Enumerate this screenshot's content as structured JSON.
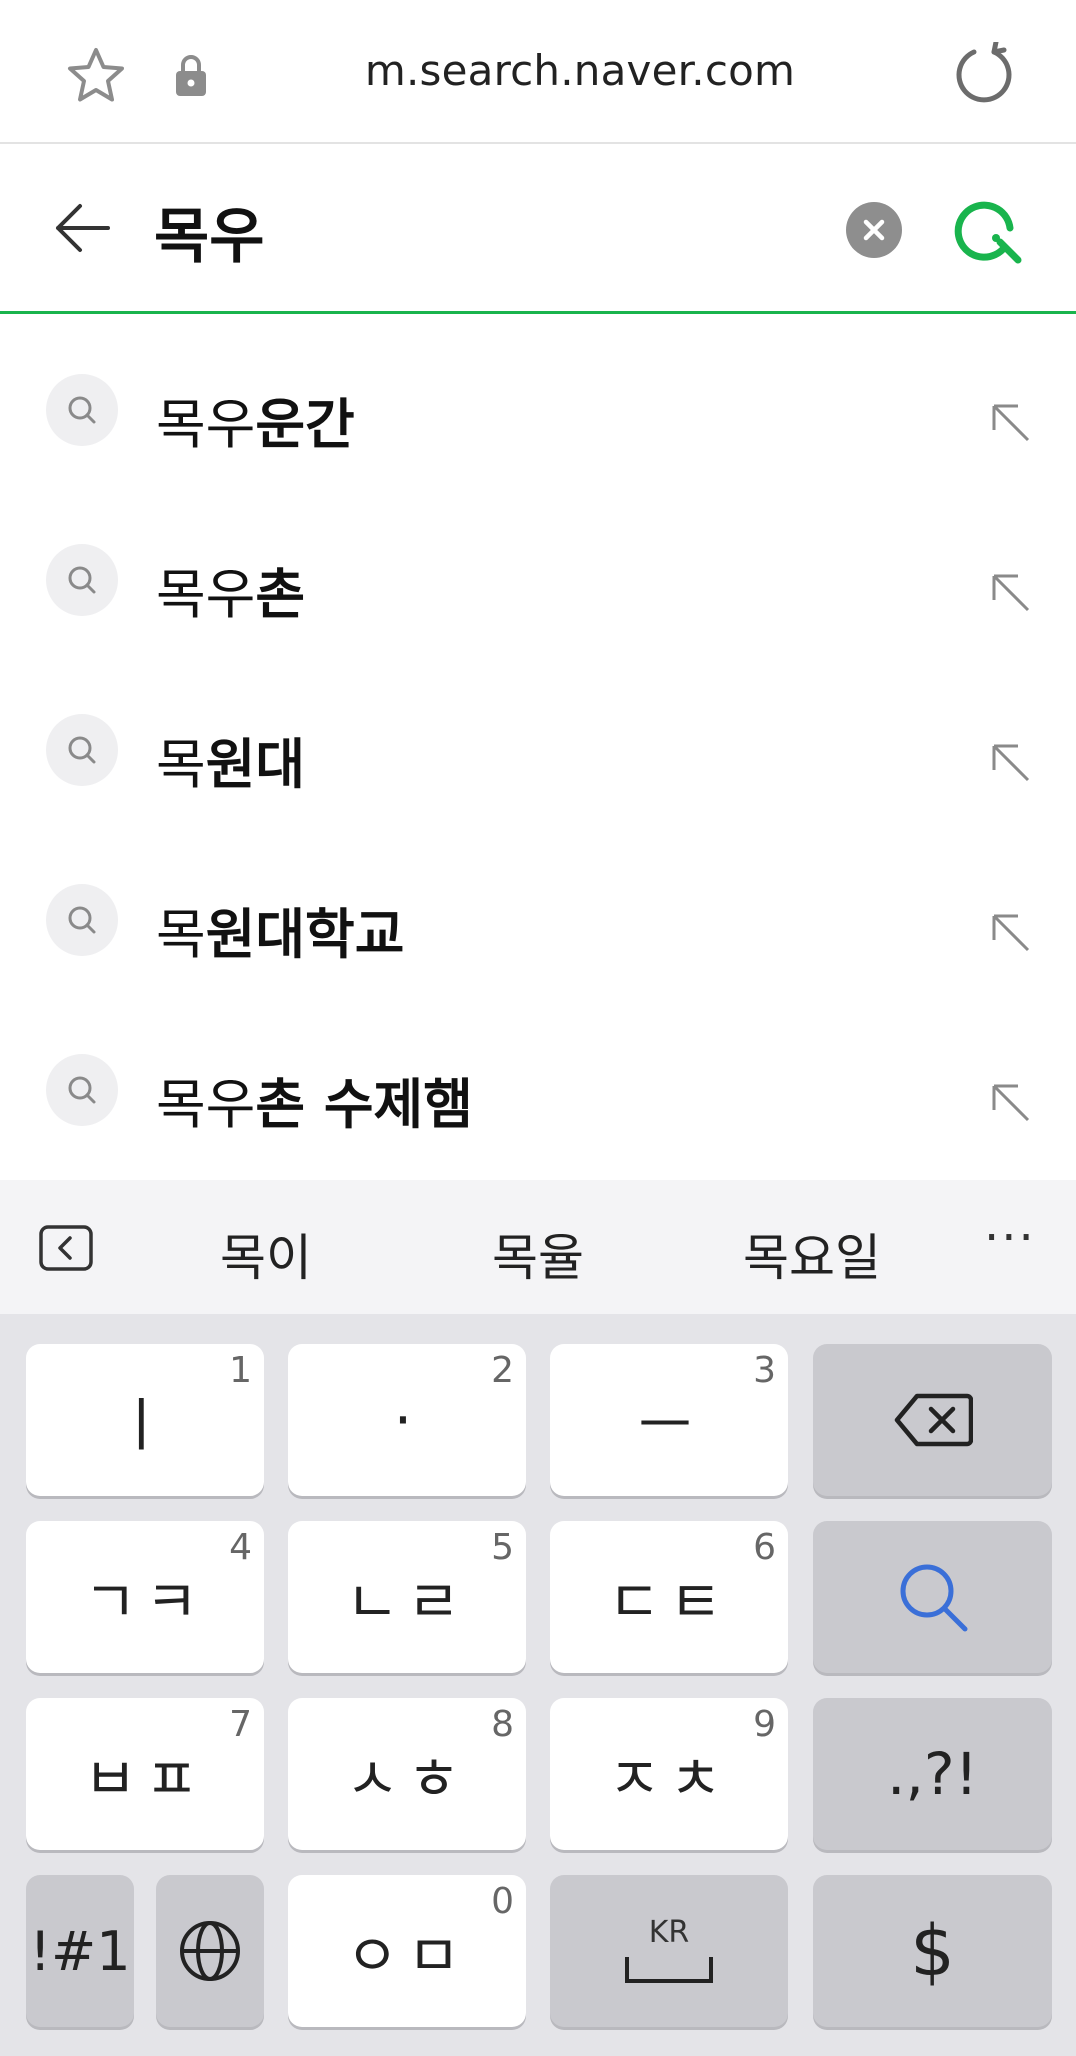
{
  "browser": {
    "url": "m.search.naver.com"
  },
  "search": {
    "query": "목우"
  },
  "suggestions": [
    {
      "typed": "목우",
      "rest": "운간"
    },
    {
      "typed": "목우",
      "rest": "촌"
    },
    {
      "typed": "목",
      "rest": "원대"
    },
    {
      "typed": "목",
      "rest": "원대학교"
    },
    {
      "typed": "목우",
      "rest": "촌 수제햄"
    }
  ],
  "predictions": {
    "words": [
      "목이",
      "목율",
      "목요일"
    ],
    "more": "···"
  },
  "keyboard": {
    "row1": [
      {
        "label": "ㅣ",
        "num": "1"
      },
      {
        "label": "·",
        "num": "2"
      },
      {
        "label": "ㅡ",
        "num": "3"
      }
    ],
    "row2": [
      {
        "label": "ㄱㅋ",
        "num": "4"
      },
      {
        "label": "ㄴㄹ",
        "num": "5"
      },
      {
        "label": "ㄷㅌ",
        "num": "6"
      }
    ],
    "row3": [
      {
        "label": "ㅂㅍ",
        "num": "7"
      },
      {
        "label": "ㅅㅎ",
        "num": "8"
      },
      {
        "label": "ㅈㅊ",
        "num": "9"
      }
    ],
    "punct": ".,?!",
    "symbols": "!#1",
    "ieung": {
      "label": "ㅇㅁ",
      "num": "0"
    },
    "space_lang": "KR",
    "dollar": "$"
  },
  "colors": {
    "accent": "#19b44d",
    "search_key": "#3a6fd8"
  }
}
